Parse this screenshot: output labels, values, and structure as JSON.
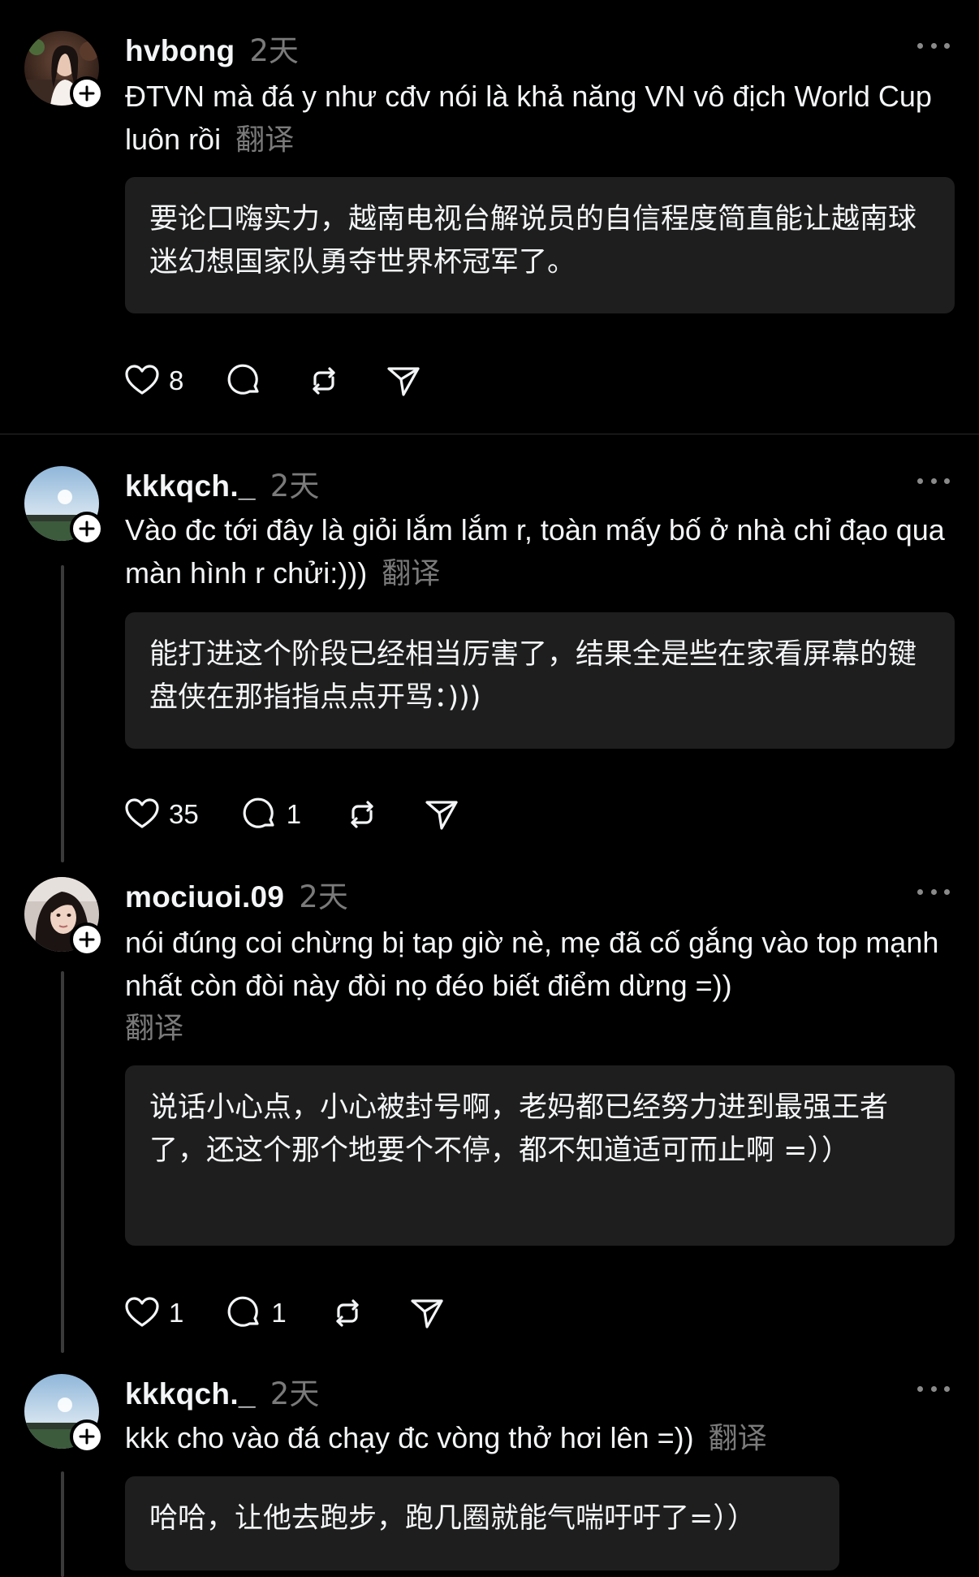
{
  "posts": [
    {
      "username": "hvbong",
      "time": "2天",
      "text": "ĐTVN mà đá y như cđv nói là khả năng VN vô địch World Cup luôn rồi",
      "translate_label": "翻译",
      "translation": "要论口嗨实力，越南电视台解说员的自信程度简直能让越南球迷幻想国家队勇夺世界杯冠军了。",
      "likes": "8",
      "replies": "",
      "avatar": "portrait-photo"
    },
    {
      "username": "kkkqch._",
      "time": "2天",
      "text": "Vào đc tới đây là giỏi lắm lắm r, toàn mấy bố ở nhà chỉ đạo qua màn hình r chửi:)))",
      "translate_label": "翻译",
      "translation": "能打进这个阶段已经相当厉害了，结果全是些在家看屏幕的键盘侠在那指指点点开骂：)))",
      "likes": "35",
      "replies": "1",
      "avatar": "sky-landscape-photo"
    },
    {
      "username": "mociuoi.09",
      "time": "2天",
      "text": "nói đúng coi chừng bị tap giờ nè, mẹ đã cố gắng vào top mạnh nhất còn đòi này đòi nọ đéo biết điểm dừng =))",
      "translate_label": "翻译",
      "translation": "说话小心点，小心被封号啊，老妈都已经努力进到最强王者了，还这个那个地要个不停，都不知道适可而止啊 =））",
      "likes": "1",
      "replies": "1",
      "avatar": "selfie-photo"
    },
    {
      "username": "kkkqch._",
      "time": "2天",
      "text": "kkk cho vào đá chạy đc vòng thở hơi lên =))",
      "translate_label": "翻译",
      "translation": "哈哈，让他去跑步，跑几圈就能气喘吁吁了=））",
      "likes": "",
      "replies": "",
      "avatar": "sky-landscape-photo"
    }
  ],
  "icons": {
    "like": "heart-icon",
    "reply": "comment-bubble-icon",
    "repost": "repost-icon",
    "share": "send-icon",
    "more": "more-dots-icon",
    "follow": "plus-icon"
  },
  "colors": {
    "background": "#000000",
    "text": "#f3f5f7",
    "secondary": "#7a7a7a",
    "translation_box": "#1e1e1e",
    "thread_line": "#3a3a3a"
  }
}
